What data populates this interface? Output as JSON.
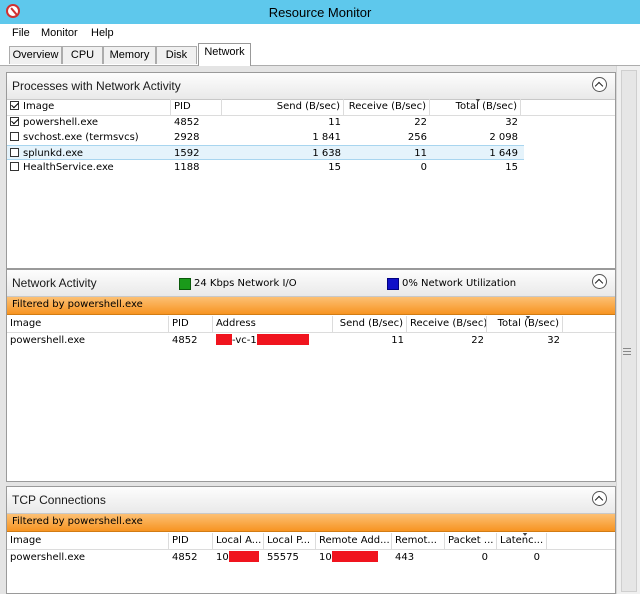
{
  "window": {
    "title": "Resource Monitor"
  },
  "menu": [
    "File",
    "Monitor",
    "Help"
  ],
  "tabs": [
    "Overview",
    "CPU",
    "Memory",
    "Disk",
    "Network"
  ],
  "processes": {
    "title": "Processes with Network Activity",
    "columns": [
      "Image",
      "PID",
      "Send (B/sec)",
      "Receive (B/sec)",
      "Total (B/sec)"
    ],
    "rows": [
      [
        "powershell.exe",
        "4852",
        "11",
        "22",
        "32"
      ],
      [
        "svchost.exe (termsvcs)",
        "2928",
        "1 841",
        "256",
        "2 098"
      ],
      [
        "splunkd.exe",
        "1592",
        "1 638",
        "11",
        "1 649"
      ],
      [
        "HealthService.exe",
        "1188",
        "15",
        "0",
        "15"
      ]
    ]
  },
  "network_activity": {
    "title": "Network Activity",
    "io_label": "24 Kbps Network I/O",
    "util_label": "0% Network Utilization",
    "filter": "Filtered by powershell.exe",
    "columns": [
      "Image",
      "PID",
      "Address",
      "Send (B/sec)",
      "Receive (B/sec)",
      "Total (B/sec)"
    ],
    "rows": [
      {
        "image": "powershell.exe",
        "pid": "4852",
        "address": "-vc-1",
        "send": "11",
        "receive": "22",
        "total": "32"
      }
    ]
  },
  "tcp": {
    "title": "TCP Connections",
    "filter": "Filtered by powershell.exe",
    "columns": [
      "Image",
      "PID",
      "Local A...",
      "Local P...",
      "Remote Add...",
      "Remot...",
      "Packet ...",
      "Latenc..."
    ],
    "rows": [
      {
        "image": "powershell.exe",
        "pid": "4852",
        "local_addr": "10",
        "local_port": "55575",
        "remote_addr": "10",
        "remote_port": "443",
        "packet_loss": "0",
        "latency": "0"
      }
    ]
  },
  "colors": {
    "titlebar": "#5ec8ec",
    "filter": "#f79422",
    "redact": "#f0141e"
  }
}
